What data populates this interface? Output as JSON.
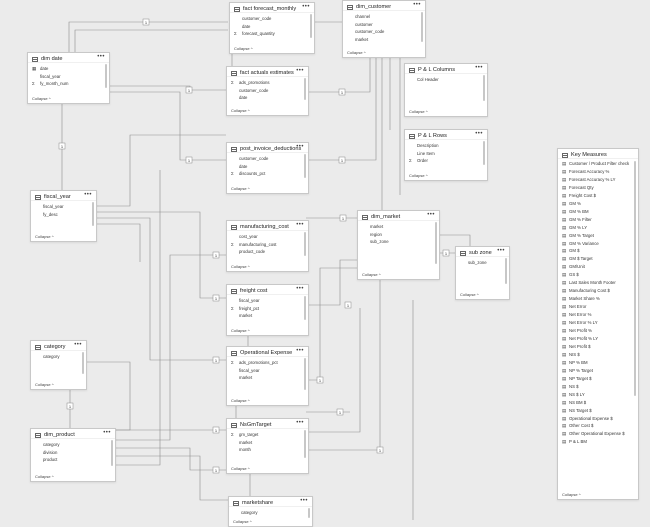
{
  "collapse_label": "Collapse",
  "more_glyph": "•••",
  "sum_glyph": "Σ",
  "tables": [
    {
      "id": "fact-forecast-monthly",
      "title": "fact forecast_monthly",
      "fields": [
        {
          "t": "customer_code"
        },
        {
          "t": "date"
        },
        {
          "t": "forecast_quantity",
          "sum": true
        }
      ]
    },
    {
      "id": "dim-customer",
      "title": "dim_customer",
      "fields": [
        {
          "t": "channel"
        },
        {
          "t": "customer"
        },
        {
          "t": "customer_code"
        },
        {
          "t": "market"
        }
      ]
    },
    {
      "id": "dim-date",
      "title": "dim date",
      "fields": [
        {
          "t": "date",
          "cal": true
        },
        {
          "t": "fiscal_year"
        },
        {
          "t": "fy_month_num",
          "sum": true
        }
      ]
    },
    {
      "id": "fact-actuals-estimates",
      "title": "fact actuals estimates",
      "fields": [
        {
          "t": "ads_promotions",
          "sum": true
        },
        {
          "t": "customer_code"
        },
        {
          "t": "date"
        }
      ]
    },
    {
      "id": "pl-columns",
      "title": "P & L Columns",
      "fields": [
        {
          "t": "Col Header"
        }
      ]
    },
    {
      "id": "pl-rows",
      "title": "P & L Rows",
      "fields": [
        {
          "t": "Description"
        },
        {
          "t": "Line Item"
        },
        {
          "t": "Order",
          "sum": true
        }
      ]
    },
    {
      "id": "post-invoice-deductions",
      "title": "post_invoice_deductions",
      "fields": [
        {
          "t": "customer_code"
        },
        {
          "t": "date"
        },
        {
          "t": "discounts_pct",
          "sum": true
        }
      ]
    },
    {
      "id": "fiscal-year",
      "title": "fiscal_year",
      "fields": [
        {
          "t": "fiscal_year"
        },
        {
          "t": "fy_desc"
        }
      ]
    },
    {
      "id": "manufacturing-cost",
      "title": "manufacturing_cost",
      "fields": [
        {
          "t": "cost_year"
        },
        {
          "t": "manufacturing_cost",
          "sum": true
        },
        {
          "t": "product_code"
        }
      ]
    },
    {
      "id": "dim-market",
      "title": "dim_market",
      "fields": [
        {
          "t": "market"
        },
        {
          "t": "region"
        },
        {
          "t": "sub_zone"
        }
      ]
    },
    {
      "id": "sub-zone",
      "title": "sub zone",
      "fields": [
        {
          "t": "sub_zone"
        }
      ]
    },
    {
      "id": "freight-cost",
      "title": "freight cost",
      "fields": [
        {
          "t": "fiscal_year"
        },
        {
          "t": "freight_pct",
          "sum": true
        },
        {
          "t": "market"
        }
      ]
    },
    {
      "id": "category",
      "title": "category",
      "fields": [
        {
          "t": "category"
        }
      ]
    },
    {
      "id": "operational-expense",
      "title": "Operational Expense",
      "fields": [
        {
          "t": "ads_promotions_pct",
          "sum": true
        },
        {
          "t": "fiscal_year"
        },
        {
          "t": "market"
        }
      ]
    },
    {
      "id": "nsgm-target",
      "title": "NsGmTarget",
      "fields": [
        {
          "t": "gm_target",
          "sum": true
        },
        {
          "t": "market"
        },
        {
          "t": "month"
        }
      ]
    },
    {
      "id": "dim-product",
      "title": "dim_product",
      "fields": [
        {
          "t": "category"
        },
        {
          "t": "division"
        },
        {
          "t": "product"
        }
      ]
    },
    {
      "id": "marketshare",
      "title": "marketshare",
      "fields": [
        {
          "t": "category"
        }
      ]
    }
  ],
  "key_measures": {
    "title": "Key Measures",
    "items": [
      "Customer / Product Filter check",
      "Forecast Accuracy %",
      "Forecast Accuracy % LY",
      "Forecast Qty",
      "Freight Cost $",
      "GM %",
      "GM % BM",
      "GM % Filter",
      "GM % LY",
      "GM % Target",
      "GM % Variance",
      "GM $",
      "GM $ Target",
      "GM/Unit",
      "GS $",
      "Last Sales Month Footer",
      "Manufacturing Cost $",
      "Market Share %",
      "Net Error",
      "Net Error %",
      "Net Error % LY",
      "Net Profit %",
      "Net Profit % LY",
      "Net Profit $",
      "NIS $",
      "NP % BM",
      "NP % Target",
      "NP Target $",
      "NS $",
      "NS $ LY",
      "NS BM $",
      "NS Target $",
      "Operational Expense $",
      "Other Cost $",
      "Other Operational Expense $",
      "P & L BM"
    ]
  },
  "relationship_labels": [
    "1",
    "*"
  ]
}
